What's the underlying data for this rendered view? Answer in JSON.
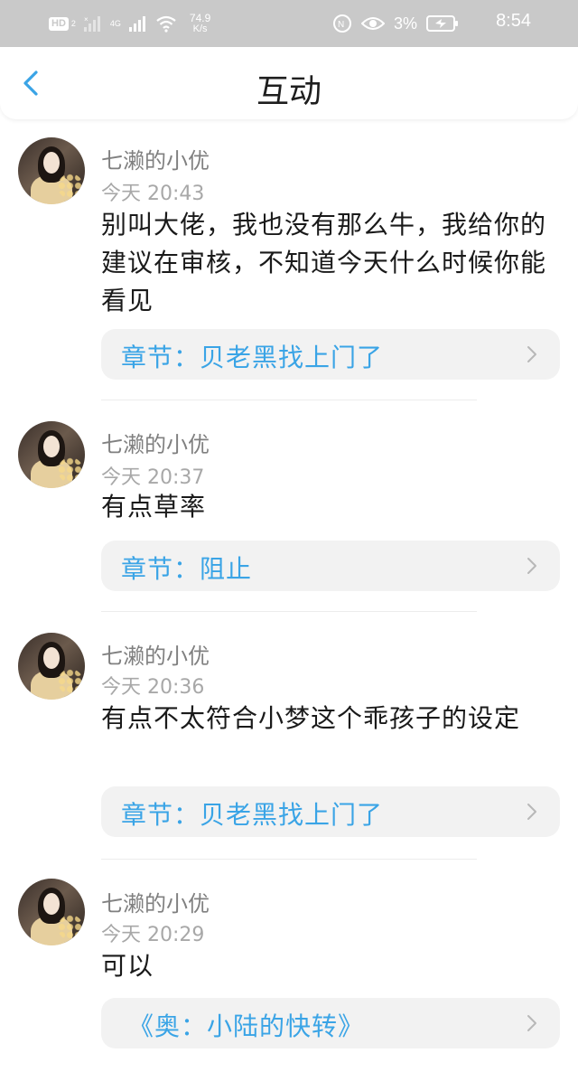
{
  "status_bar": {
    "hd_label": "HD",
    "sim_slot": "2",
    "network_type": "4G",
    "net_speed_value": "74.9",
    "net_speed_unit": "K/s",
    "battery_percent": "3%",
    "time": "8:54"
  },
  "header": {
    "title": "互动"
  },
  "comments": [
    {
      "user": "七濑的小优",
      "time": "今天 20:43",
      "text": "别叫大佬，我也没有那么牛，我给你的建议在审核，不知道今天什么时候你能看见",
      "chapter": "章节：贝老黑找上门了"
    },
    {
      "user": "七濑的小优",
      "time": "今天 20:37",
      "text": "有点草率",
      "chapter": "章节：阻止"
    },
    {
      "user": "七濑的小优",
      "time": "今天 20:36",
      "text": "有点不太符合小梦这个乖孩子的设定",
      "chapter": "章节：贝老黑找上门了"
    },
    {
      "user": "七濑的小优",
      "time": "今天 20:29",
      "text": "可以",
      "chapter": "《奥：小陆的快转》"
    }
  ],
  "colors": {
    "status_bar_bg": "#c9c9c9",
    "accent": "#3aa4e6",
    "card_bg": "#f2f2f2"
  }
}
